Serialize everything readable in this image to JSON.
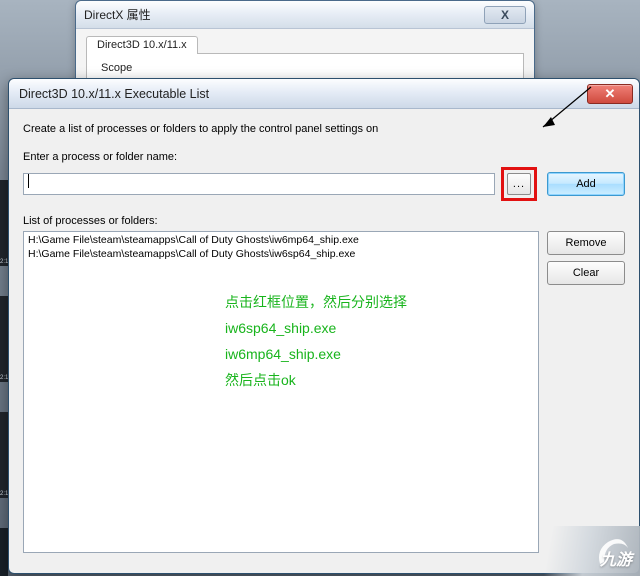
{
  "back_window": {
    "title": "DirectX 属性",
    "close_glyph": "X",
    "tab_label": "Direct3D 10.x/11.x",
    "panel_first_line": "Scope"
  },
  "front_window": {
    "title": "Direct3D 10.x/11.x Executable List",
    "instruction": "Create a list of processes or folders to apply the control panel settings on",
    "enter_label": "Enter a process or folder name:",
    "browse_label": "...",
    "add_label": "Add",
    "list_label": "List of processes or folders:",
    "list_items": [
      "H:\\Game File\\steam\\steamapps\\Call of Duty Ghosts\\iw6mp64_ship.exe",
      "H:\\Game File\\steam\\steamapps\\Call of Duty Ghosts\\iw6sp64_ship.exe"
    ],
    "remove_label": "Remove",
    "clear_label": "Clear",
    "close_glyph": "✕",
    "input_value": ""
  },
  "annotation": {
    "line1": "点击红框位置，然后分别选择",
    "line2": "iw6sp64_ship.exe",
    "line3": "iw6mp64_ship.exe",
    "line4": "然后点击ok"
  },
  "thumbs": {
    "time": "2:1"
  },
  "logo": {
    "text": "九游"
  }
}
